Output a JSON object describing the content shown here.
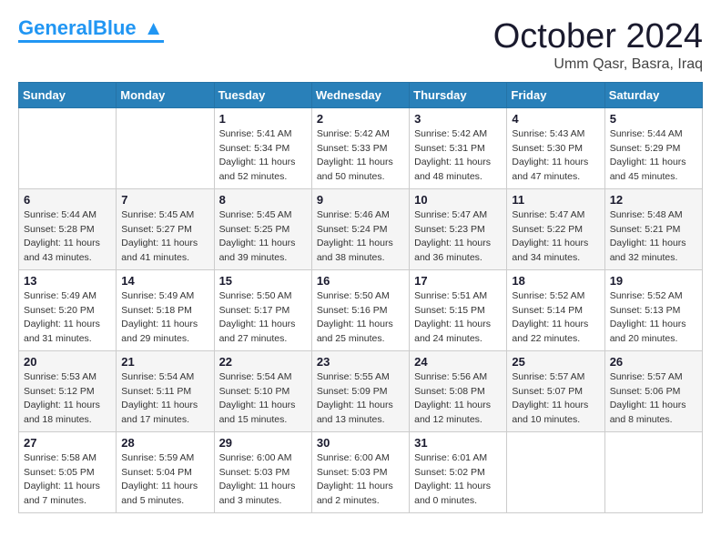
{
  "header": {
    "logo_general": "General",
    "logo_blue": "Blue",
    "month_title": "October 2024",
    "location": "Umm Qasr, Basra, Iraq"
  },
  "weekdays": [
    "Sunday",
    "Monday",
    "Tuesday",
    "Wednesday",
    "Thursday",
    "Friday",
    "Saturday"
  ],
  "weeks": [
    [
      {
        "day": "",
        "sunrise": "",
        "sunset": "",
        "daylight": ""
      },
      {
        "day": "",
        "sunrise": "",
        "sunset": "",
        "daylight": ""
      },
      {
        "day": "1",
        "sunrise": "Sunrise: 5:41 AM",
        "sunset": "Sunset: 5:34 PM",
        "daylight": "Daylight: 11 hours and 52 minutes."
      },
      {
        "day": "2",
        "sunrise": "Sunrise: 5:42 AM",
        "sunset": "Sunset: 5:33 PM",
        "daylight": "Daylight: 11 hours and 50 minutes."
      },
      {
        "day": "3",
        "sunrise": "Sunrise: 5:42 AM",
        "sunset": "Sunset: 5:31 PM",
        "daylight": "Daylight: 11 hours and 48 minutes."
      },
      {
        "day": "4",
        "sunrise": "Sunrise: 5:43 AM",
        "sunset": "Sunset: 5:30 PM",
        "daylight": "Daylight: 11 hours and 47 minutes."
      },
      {
        "day": "5",
        "sunrise": "Sunrise: 5:44 AM",
        "sunset": "Sunset: 5:29 PM",
        "daylight": "Daylight: 11 hours and 45 minutes."
      }
    ],
    [
      {
        "day": "6",
        "sunrise": "Sunrise: 5:44 AM",
        "sunset": "Sunset: 5:28 PM",
        "daylight": "Daylight: 11 hours and 43 minutes."
      },
      {
        "day": "7",
        "sunrise": "Sunrise: 5:45 AM",
        "sunset": "Sunset: 5:27 PM",
        "daylight": "Daylight: 11 hours and 41 minutes."
      },
      {
        "day": "8",
        "sunrise": "Sunrise: 5:45 AM",
        "sunset": "Sunset: 5:25 PM",
        "daylight": "Daylight: 11 hours and 39 minutes."
      },
      {
        "day": "9",
        "sunrise": "Sunrise: 5:46 AM",
        "sunset": "Sunset: 5:24 PM",
        "daylight": "Daylight: 11 hours and 38 minutes."
      },
      {
        "day": "10",
        "sunrise": "Sunrise: 5:47 AM",
        "sunset": "Sunset: 5:23 PM",
        "daylight": "Daylight: 11 hours and 36 minutes."
      },
      {
        "day": "11",
        "sunrise": "Sunrise: 5:47 AM",
        "sunset": "Sunset: 5:22 PM",
        "daylight": "Daylight: 11 hours and 34 minutes."
      },
      {
        "day": "12",
        "sunrise": "Sunrise: 5:48 AM",
        "sunset": "Sunset: 5:21 PM",
        "daylight": "Daylight: 11 hours and 32 minutes."
      }
    ],
    [
      {
        "day": "13",
        "sunrise": "Sunrise: 5:49 AM",
        "sunset": "Sunset: 5:20 PM",
        "daylight": "Daylight: 11 hours and 31 minutes."
      },
      {
        "day": "14",
        "sunrise": "Sunrise: 5:49 AM",
        "sunset": "Sunset: 5:18 PM",
        "daylight": "Daylight: 11 hours and 29 minutes."
      },
      {
        "day": "15",
        "sunrise": "Sunrise: 5:50 AM",
        "sunset": "Sunset: 5:17 PM",
        "daylight": "Daylight: 11 hours and 27 minutes."
      },
      {
        "day": "16",
        "sunrise": "Sunrise: 5:50 AM",
        "sunset": "Sunset: 5:16 PM",
        "daylight": "Daylight: 11 hours and 25 minutes."
      },
      {
        "day": "17",
        "sunrise": "Sunrise: 5:51 AM",
        "sunset": "Sunset: 5:15 PM",
        "daylight": "Daylight: 11 hours and 24 minutes."
      },
      {
        "day": "18",
        "sunrise": "Sunrise: 5:52 AM",
        "sunset": "Sunset: 5:14 PM",
        "daylight": "Daylight: 11 hours and 22 minutes."
      },
      {
        "day": "19",
        "sunrise": "Sunrise: 5:52 AM",
        "sunset": "Sunset: 5:13 PM",
        "daylight": "Daylight: 11 hours and 20 minutes."
      }
    ],
    [
      {
        "day": "20",
        "sunrise": "Sunrise: 5:53 AM",
        "sunset": "Sunset: 5:12 PM",
        "daylight": "Daylight: 11 hours and 18 minutes."
      },
      {
        "day": "21",
        "sunrise": "Sunrise: 5:54 AM",
        "sunset": "Sunset: 5:11 PM",
        "daylight": "Daylight: 11 hours and 17 minutes."
      },
      {
        "day": "22",
        "sunrise": "Sunrise: 5:54 AM",
        "sunset": "Sunset: 5:10 PM",
        "daylight": "Daylight: 11 hours and 15 minutes."
      },
      {
        "day": "23",
        "sunrise": "Sunrise: 5:55 AM",
        "sunset": "Sunset: 5:09 PM",
        "daylight": "Daylight: 11 hours and 13 minutes."
      },
      {
        "day": "24",
        "sunrise": "Sunrise: 5:56 AM",
        "sunset": "Sunset: 5:08 PM",
        "daylight": "Daylight: 11 hours and 12 minutes."
      },
      {
        "day": "25",
        "sunrise": "Sunrise: 5:57 AM",
        "sunset": "Sunset: 5:07 PM",
        "daylight": "Daylight: 11 hours and 10 minutes."
      },
      {
        "day": "26",
        "sunrise": "Sunrise: 5:57 AM",
        "sunset": "Sunset: 5:06 PM",
        "daylight": "Daylight: 11 hours and 8 minutes."
      }
    ],
    [
      {
        "day": "27",
        "sunrise": "Sunrise: 5:58 AM",
        "sunset": "Sunset: 5:05 PM",
        "daylight": "Daylight: 11 hours and 7 minutes."
      },
      {
        "day": "28",
        "sunrise": "Sunrise: 5:59 AM",
        "sunset": "Sunset: 5:04 PM",
        "daylight": "Daylight: 11 hours and 5 minutes."
      },
      {
        "day": "29",
        "sunrise": "Sunrise: 6:00 AM",
        "sunset": "Sunset: 5:03 PM",
        "daylight": "Daylight: 11 hours and 3 minutes."
      },
      {
        "day": "30",
        "sunrise": "Sunrise: 6:00 AM",
        "sunset": "Sunset: 5:03 PM",
        "daylight": "Daylight: 11 hours and 2 minutes."
      },
      {
        "day": "31",
        "sunrise": "Sunrise: 6:01 AM",
        "sunset": "Sunset: 5:02 PM",
        "daylight": "Daylight: 11 hours and 0 minutes."
      },
      {
        "day": "",
        "sunrise": "",
        "sunset": "",
        "daylight": ""
      },
      {
        "day": "",
        "sunrise": "",
        "sunset": "",
        "daylight": ""
      }
    ]
  ]
}
